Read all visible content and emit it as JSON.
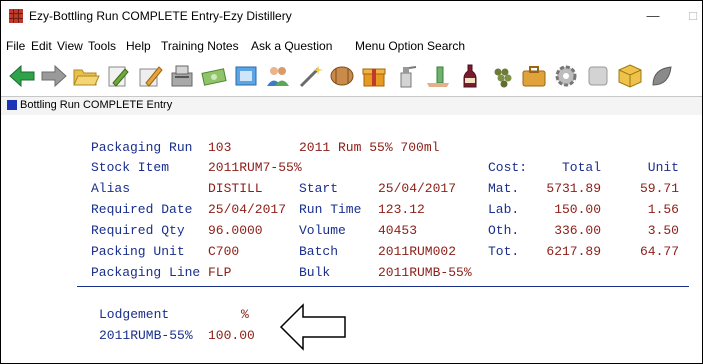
{
  "window": {
    "title": "Ezy-Bottling Run COMPLETE Entry-Ezy Distillery",
    "min": "—",
    "max": "□"
  },
  "menu": [
    "File",
    "Edit",
    "View",
    "Tools",
    "Help",
    "Training Notes",
    "Ask a Question",
    "Menu Option Search"
  ],
  "toolbar": [
    "back-arrow-icon",
    "forward-arrow-icon",
    "folder-open-icon",
    "document-edit-icon",
    "pencil-edit-icon",
    "cash-register-icon",
    "cash-bills-icon",
    "box-window-icon",
    "people-icon",
    "magic-wand-icon",
    "barrel-icon",
    "gift-box-icon",
    "spray-bottle-icon",
    "hand-bottle-icon",
    "wine-bottle-icon",
    "grapes-icon",
    "briefcase-icon",
    "gear-icon",
    "gray-panel-icon",
    "cube-icon",
    "leaf-icon"
  ],
  "panel": {
    "title": "Bottling Run COMPLETE Entry"
  },
  "form": {
    "packaging_run_label": "Packaging Run",
    "packaging_run": "103",
    "packaging_run_desc": "2011 Rum 55% 700ml",
    "stock_item_label": "Stock Item",
    "stock_item": "2011RUM7-55%",
    "alias_label": "Alias",
    "alias": "DISTILL",
    "required_date_label": "Required Date",
    "required_date": "25/04/2017",
    "required_qty_label": "Required Qty",
    "required_qty": "96.0000",
    "packing_unit_label": "Packing Unit",
    "packing_unit": "C700",
    "packaging_line_label": "Packaging Line",
    "packaging_line": "FLP",
    "start_label": "Start",
    "start": "25/04/2017",
    "run_time_label": "Run Time",
    "run_time": "123.12",
    "volume_label": "Volume",
    "volume": "40453",
    "batch_label": "Batch",
    "batch": "2011RUM002",
    "bulk_label": "Bulk",
    "bulk": "2011RUMB-55%"
  },
  "cost": {
    "header": "Cost:",
    "total_header": "Total",
    "unit_header": "Unit",
    "rows": [
      {
        "label": "Mat.",
        "total": "5731.89",
        "unit": "59.71"
      },
      {
        "label": "Lab.",
        "total": "150.00",
        "unit": "1.56"
      },
      {
        "label": "Oth.",
        "total": "336.00",
        "unit": "3.50"
      },
      {
        "label": "Tot.",
        "total": "6217.89",
        "unit": "64.77"
      }
    ]
  },
  "lodgement": {
    "header": "Lodgement",
    "pct_header": "%",
    "item": "2011RUMB-55%",
    "pct": "100.00"
  }
}
